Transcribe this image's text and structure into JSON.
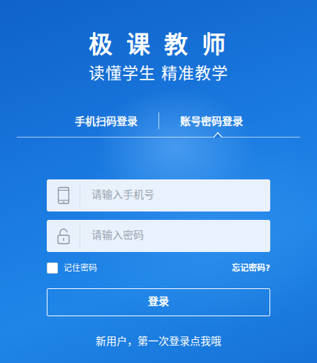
{
  "app": {
    "title": "极 课 教 师",
    "slogan": "读懂学生 精准教学"
  },
  "tabs": [
    {
      "label": "手机扫码登录",
      "selected": false
    },
    {
      "label": "账号密码登录",
      "selected": true
    }
  ],
  "form": {
    "phone": {
      "placeholder": "请输入手机号"
    },
    "password": {
      "placeholder": "请输入密码"
    },
    "remember": {
      "label": "记住密码",
      "checked": false
    },
    "forgot": "忘记密码?",
    "submit": "登录"
  },
  "signup": "新用户，第一次登录点我哦"
}
